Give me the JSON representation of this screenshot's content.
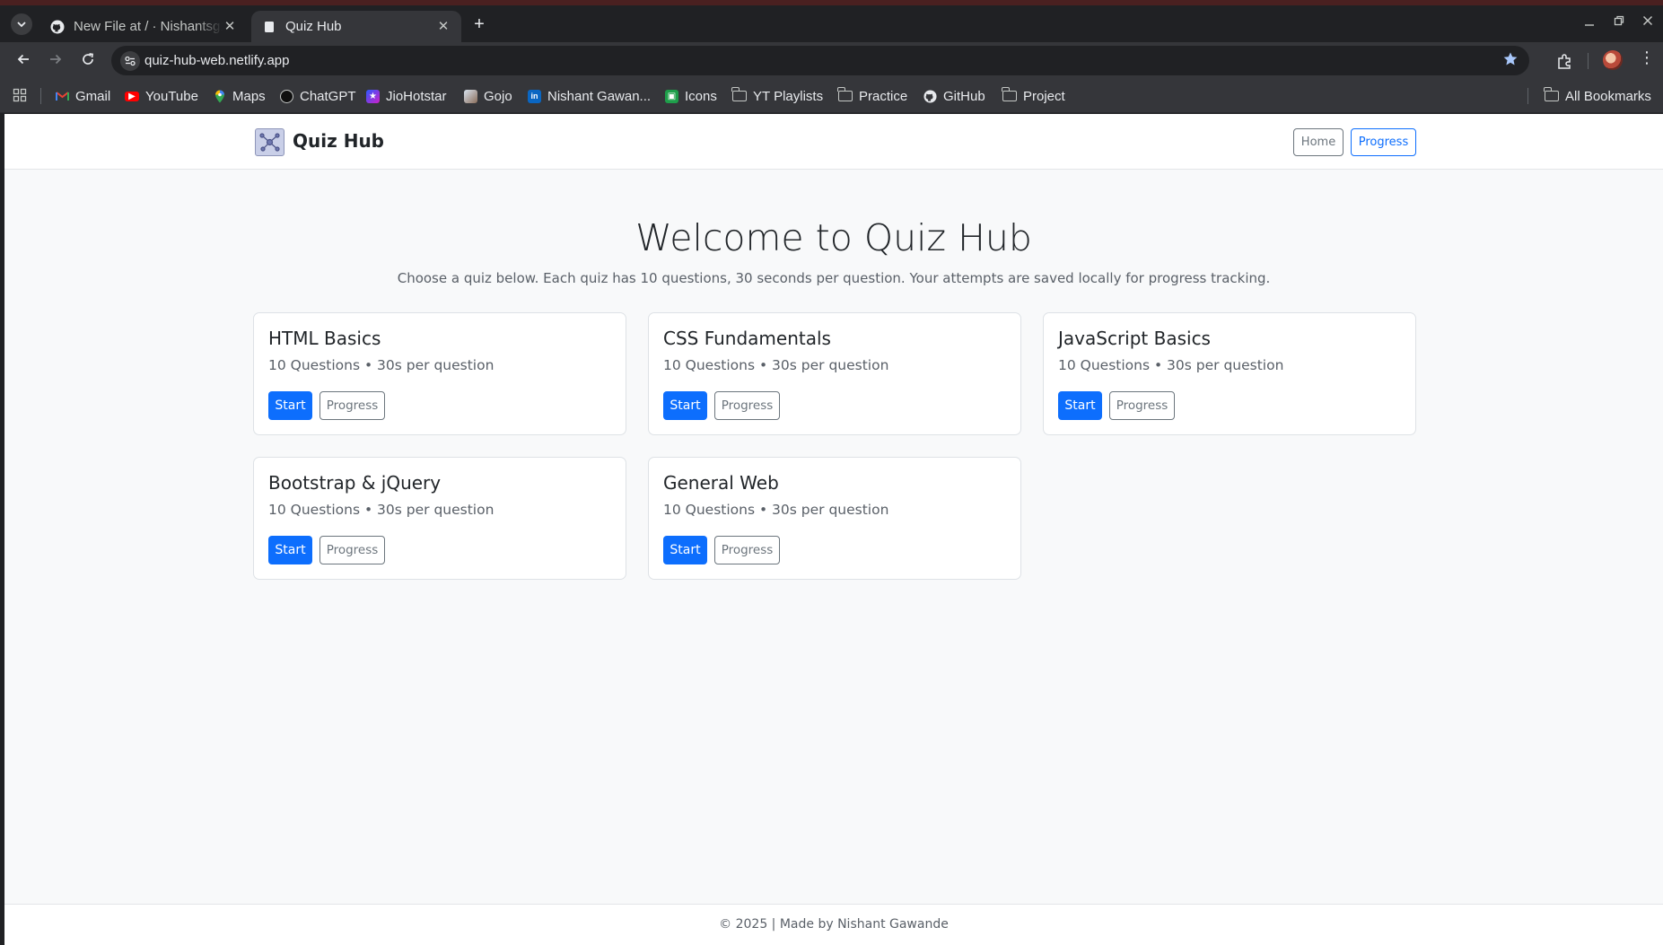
{
  "browser": {
    "tabs": [
      {
        "title": "New File at / · Nishantsg1",
        "favicon": "github-icon",
        "active": false
      },
      {
        "title": "Quiz Hub",
        "favicon": "page-icon",
        "active": true
      }
    ],
    "url": "quiz-hub-web.netlify.app",
    "bookmarks": [
      {
        "label": "Gmail",
        "icon": "gmail-icon",
        "color": "#ea4335"
      },
      {
        "label": "YouTube",
        "icon": "youtube-icon",
        "color": "#ff0000"
      },
      {
        "label": "Maps",
        "icon": "maps-icon",
        "color": "#34a853"
      },
      {
        "label": "ChatGPT",
        "icon": "chatgpt-icon",
        "color": "#202124"
      },
      {
        "label": "JioHotstar",
        "icon": "jiohotstar-icon",
        "color": "#7b2ff7"
      },
      {
        "label": "Gojo",
        "icon": "gojo-icon",
        "color": "#8a6d5a"
      },
      {
        "label": "Nishant Gawan...",
        "icon": "linkedin-icon",
        "color": "#0a66c2"
      },
      {
        "label": "Icons",
        "icon": "icons-icon",
        "color": "#1e9e4a"
      },
      {
        "label": "YT Playlists",
        "icon": "folder-icon"
      },
      {
        "label": "Practice",
        "icon": "folder-icon"
      },
      {
        "label": "GitHub",
        "icon": "github-icon"
      },
      {
        "label": "Project",
        "icon": "folder-icon"
      }
    ],
    "all_bookmarks": "All Bookmarks"
  },
  "site": {
    "brand": "Quiz Hub",
    "nav": {
      "home": "Home",
      "progress": "Progress"
    },
    "hero": {
      "title": "Welcome to Quiz Hub",
      "subtitle": "Choose a quiz below. Each quiz has 10 questions, 30 seconds per question. Your attempts are saved locally for progress tracking."
    },
    "quizzes": [
      {
        "title": "HTML Basics",
        "meta": "10 Questions • 30s per question",
        "start": "Start",
        "progress": "Progress"
      },
      {
        "title": "CSS Fundamentals",
        "meta": "10 Questions • 30s per question",
        "start": "Start",
        "progress": "Progress"
      },
      {
        "title": "JavaScript Basics",
        "meta": "10 Questions • 30s per question",
        "start": "Start",
        "progress": "Progress"
      },
      {
        "title": "Bootstrap & jQuery",
        "meta": "10 Questions • 30s per question",
        "start": "Start",
        "progress": "Progress"
      },
      {
        "title": "General Web",
        "meta": "10 Questions • 30s per question",
        "start": "Start",
        "progress": "Progress"
      }
    ],
    "footer": "© 2025 | Made by Nishant Gawande"
  },
  "colors": {
    "primary": "#0d6efd",
    "secondary": "#6c757d",
    "page_bg": "#f8f9fa",
    "browser_dark": "#202124"
  }
}
